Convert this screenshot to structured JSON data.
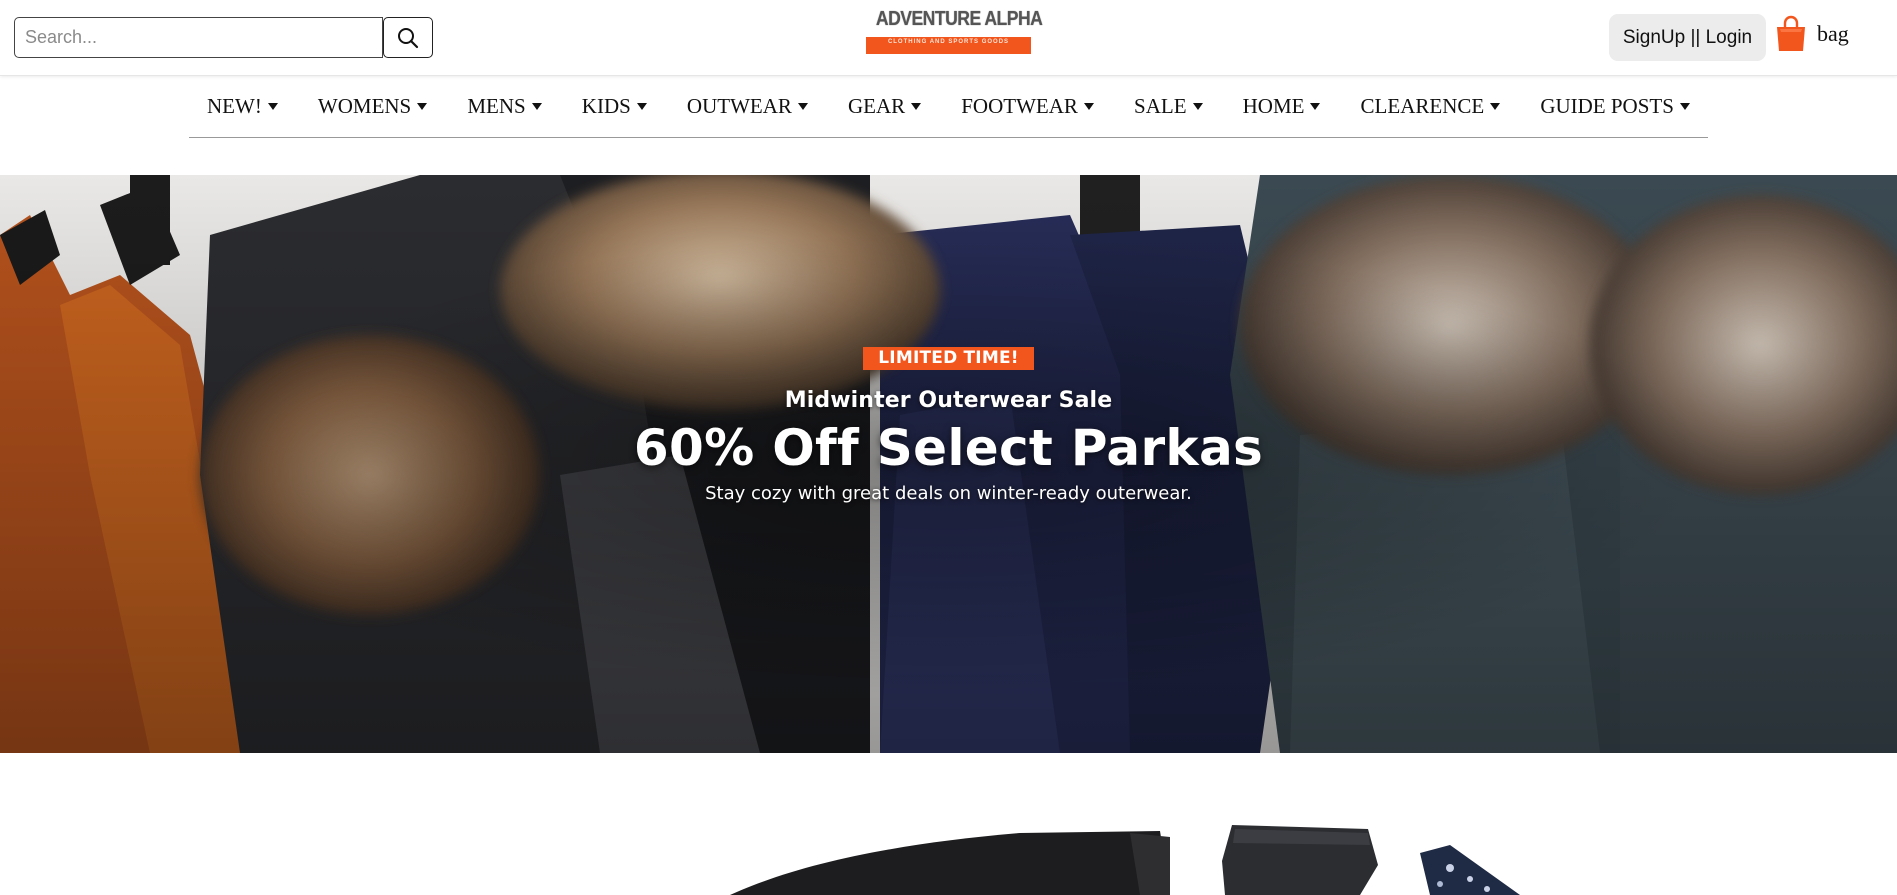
{
  "header": {
    "search_placeholder": "Search...",
    "logo": {
      "title": "ADVENTURE ALPHA",
      "tagline": "CLOTHING AND SPORTS GOODS"
    },
    "login_label": "SignUp || Login",
    "bag_label": "bag"
  },
  "nav": {
    "items": [
      {
        "label": "NEW!"
      },
      {
        "label": "WOMENS"
      },
      {
        "label": "MENS"
      },
      {
        "label": "KIDS"
      },
      {
        "label": "OUTWEAR"
      },
      {
        "label": "GEAR"
      },
      {
        "label": "FOOTWEAR"
      },
      {
        "label": "SALE"
      },
      {
        "label": "HOME"
      },
      {
        "label": "CLEARENCE"
      },
      {
        "label": "GUIDE POSTS"
      }
    ]
  },
  "hero": {
    "badge": "LIMITED TIME!",
    "subtitle": "Midwinter Outerwear Sale",
    "title": "60% Off Select Parkas",
    "description": "Stay cozy with great deals on winter-ready outerwear."
  },
  "colors": {
    "accent": "#f2561d",
    "nav_divider": "#999999",
    "login_bg": "#ececec"
  },
  "icons": {
    "search": "search-icon",
    "bag": "shopping-bag-icon",
    "caret": "caret-down-icon"
  }
}
